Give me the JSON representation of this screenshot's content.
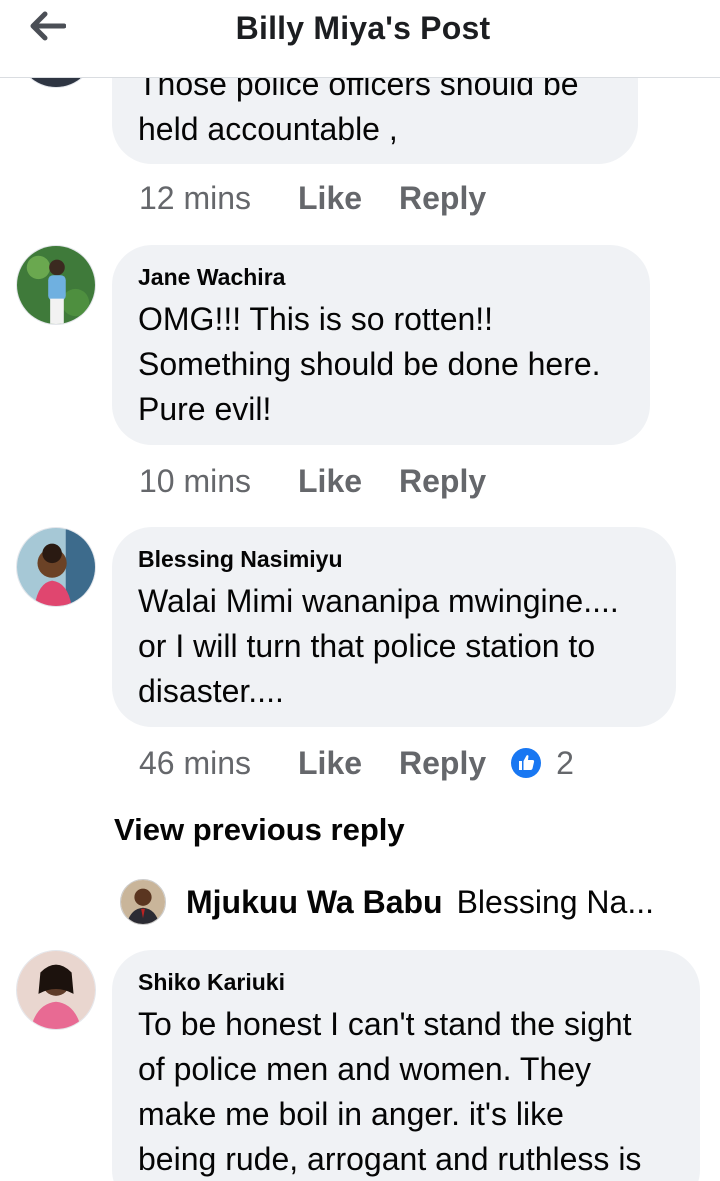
{
  "header": {
    "title": "Billy Miya's Post",
    "back_icon": "arrow-left-icon"
  },
  "comments": [
    {
      "name": "",
      "text_lines": [
        "Those police officers should be",
        "held accountable ,"
      ],
      "time": "12 mins",
      "like": "Like",
      "reply": "Reply"
    },
    {
      "name": "Jane Wachira",
      "text_lines": [
        "OMG!!! This is so rotten!!",
        "Something should be done here.",
        "Pure evil!"
      ],
      "time": "10 mins",
      "like": "Like",
      "reply": "Reply"
    },
    {
      "name": "Blessing Nasimiyu",
      "text_lines": [
        "Walai Mimi wananipa mwingine....",
        "or I will turn that police station to",
        "disaster...."
      ],
      "time": "46 mins",
      "like": "Like",
      "reply": "Reply",
      "reaction_count": "2",
      "reaction_icon": "thumbs-up-icon"
    },
    {
      "name": "Shiko Kariuki",
      "text_lines": [
        "To be honest I can't stand the sight",
        "of police men and women. They",
        "make me boil in anger. it's like",
        "being rude, arrogant and ruthless is"
      ]
    }
  ],
  "view_previous": "View previous reply",
  "reply_preview": {
    "name": "Mjukuu Wa Babu",
    "snippet": "Blessing Na..."
  },
  "colors": {
    "bubble": "#f0f2f5",
    "meta": "#65676b",
    "like_blue": "#1877f2"
  }
}
